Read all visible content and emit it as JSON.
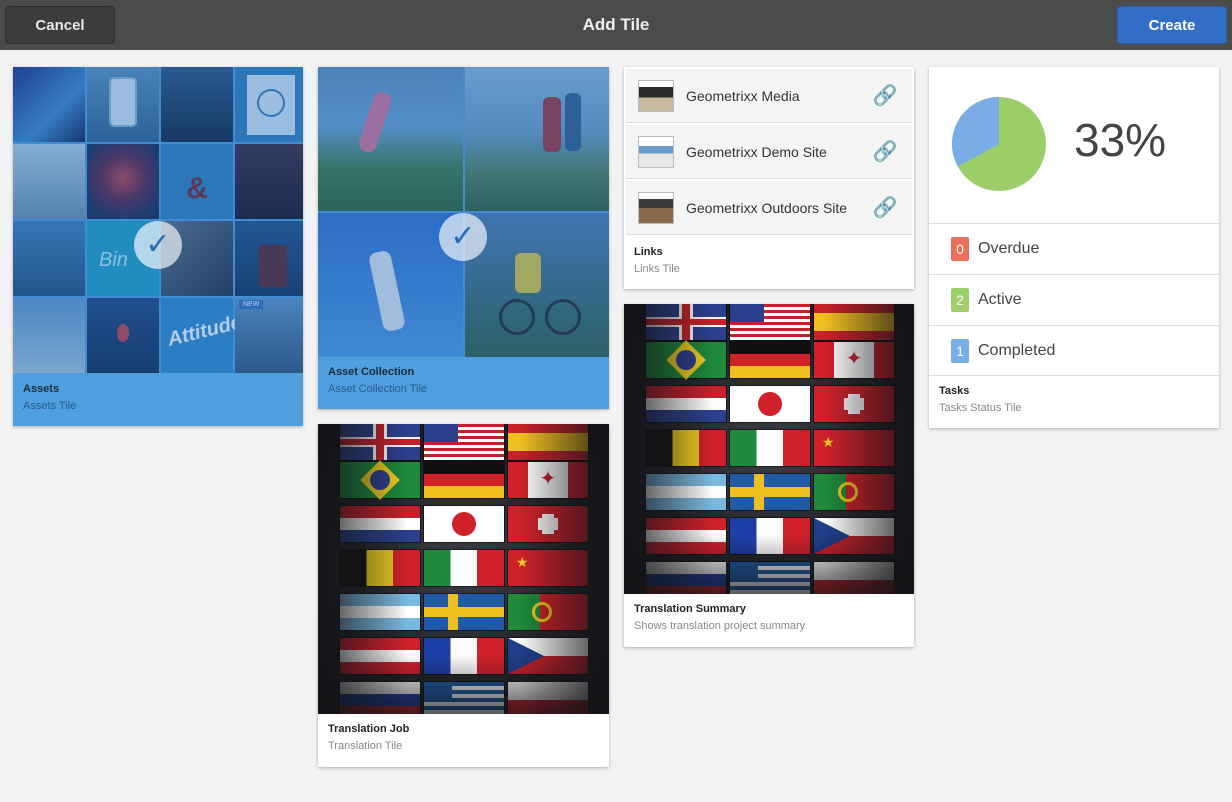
{
  "header": {
    "cancel_label": "Cancel",
    "title": "Add Tile",
    "create_label": "Create",
    "create_color": "#326ec8"
  },
  "tiles": {
    "assets": {
      "title": "Assets",
      "subtitle": "Assets Tile",
      "selected": true,
      "badge": "NEW"
    },
    "asset_collection": {
      "title": "Asset Collection",
      "subtitle": "Asset Collection Tile",
      "selected": true
    },
    "translation_job": {
      "title": "Translation Job",
      "subtitle": "Translation Tile"
    },
    "links": {
      "title": "Links",
      "subtitle": "Links Tile",
      "items": [
        {
          "name": "Geometrixx Media",
          "icon": "link-icon"
        },
        {
          "name": "Geometrixx Demo Site",
          "icon": "link-icon"
        },
        {
          "name": "Geometrixx Outdoors Site",
          "icon": "link-icon"
        }
      ]
    },
    "translation_summary": {
      "title": "Translation Summary",
      "subtitle": "Shows translation project summary"
    },
    "tasks": {
      "title": "Tasks",
      "subtitle": "Tasks Status Tile",
      "percent_label": "33%",
      "pie": {
        "completed_fraction": 0.33,
        "completed_color": "#7aade6",
        "remaining_color": "#9ccf6a"
      },
      "rows": [
        {
          "count": "0",
          "label": "Overdue",
          "color": "#ee6e5e"
        },
        {
          "count": "2",
          "label": "Active",
          "color": "#9ccf6a"
        },
        {
          "count": "1",
          "label": "Completed",
          "color": "#7aade6"
        }
      ]
    }
  }
}
